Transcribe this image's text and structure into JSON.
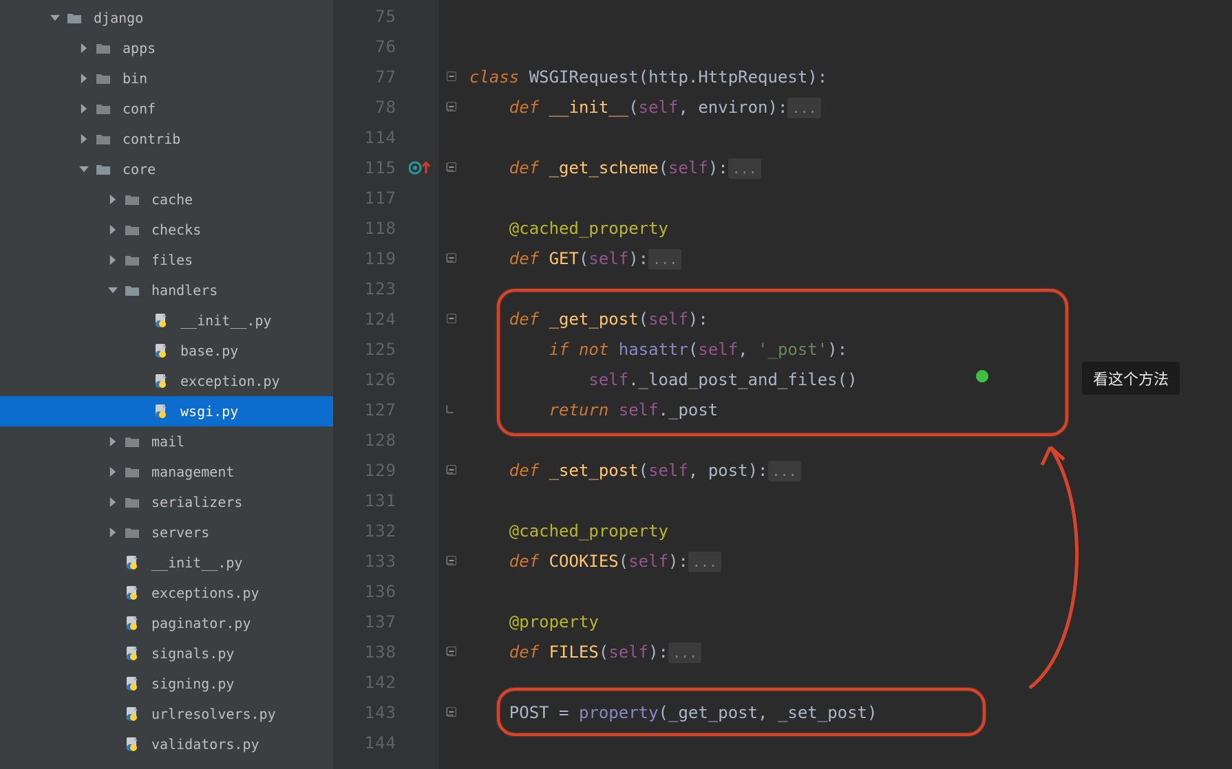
{
  "tree": [
    {
      "depth": 1,
      "kind": "folder",
      "open": true,
      "label": "django"
    },
    {
      "depth": 2,
      "kind": "folder",
      "open": false,
      "label": "apps"
    },
    {
      "depth": 2,
      "kind": "folder",
      "open": false,
      "label": "bin"
    },
    {
      "depth": 2,
      "kind": "folder",
      "open": false,
      "label": "conf"
    },
    {
      "depth": 2,
      "kind": "folder",
      "open": false,
      "label": "contrib"
    },
    {
      "depth": 2,
      "kind": "folder",
      "open": true,
      "label": "core"
    },
    {
      "depth": 3,
      "kind": "folder",
      "open": false,
      "label": "cache"
    },
    {
      "depth": 3,
      "kind": "folder",
      "open": false,
      "label": "checks"
    },
    {
      "depth": 3,
      "kind": "folder",
      "open": false,
      "label": "files"
    },
    {
      "depth": 3,
      "kind": "folder",
      "open": true,
      "label": "handlers"
    },
    {
      "depth": 4,
      "kind": "py",
      "label": "__init__.py"
    },
    {
      "depth": 4,
      "kind": "py",
      "label": "base.py"
    },
    {
      "depth": 4,
      "kind": "py",
      "label": "exception.py"
    },
    {
      "depth": 4,
      "kind": "py",
      "label": "wsgi.py",
      "selected": true
    },
    {
      "depth": 3,
      "kind": "folder",
      "open": false,
      "label": "mail"
    },
    {
      "depth": 3,
      "kind": "folder",
      "open": false,
      "label": "management"
    },
    {
      "depth": 3,
      "kind": "folder",
      "open": false,
      "label": "serializers"
    },
    {
      "depth": 3,
      "kind": "folder",
      "open": false,
      "label": "servers"
    },
    {
      "depth": 3,
      "kind": "py",
      "label": "__init__.py"
    },
    {
      "depth": 3,
      "kind": "py",
      "label": "exceptions.py"
    },
    {
      "depth": 3,
      "kind": "py",
      "label": "paginator.py"
    },
    {
      "depth": 3,
      "kind": "py",
      "label": "signals.py"
    },
    {
      "depth": 3,
      "kind": "py",
      "label": "signing.py"
    },
    {
      "depth": 3,
      "kind": "py",
      "label": "urlresolvers.py"
    },
    {
      "depth": 3,
      "kind": "py",
      "label": "validators.py"
    }
  ],
  "lineNumbers": [
    "75",
    "76",
    "77",
    "78",
    "114",
    "115",
    "117",
    "118",
    "119",
    "123",
    "124",
    "125",
    "126",
    "127",
    "128",
    "129",
    "131",
    "132",
    "133",
    "136",
    "137",
    "138",
    "142",
    "143",
    "144"
  ],
  "markers": {
    "overriding_row": 5
  },
  "folds": {
    "minus": [
      2,
      3,
      5,
      8,
      10,
      15,
      18,
      21,
      23
    ],
    "collapsed_end": [
      3,
      5,
      8,
      13,
      15,
      18,
      21,
      23
    ]
  },
  "code": {
    "kw_class": "class",
    "kw_def": "def",
    "kw_if": "if",
    "kw_not": "not",
    "kw_return": "return",
    "class_name": "WSGIRequest",
    "class_base": "http.HttpRequest",
    "init": "__init__",
    "p_self": "self",
    "p_environ": "environ",
    "get_scheme": "_get_scheme",
    "cached_property": "@cached_property",
    "property_dec": "@property",
    "GET": "GET",
    "get_post": "_get_post",
    "hasattr": "hasattr",
    "post_str": "'_post'",
    "load_call": "._load_post_and_files()",
    "post_attr": "._post",
    "set_post": "_set_post",
    "p_post": "post",
    "COOKIES": "COOKIES",
    "FILES": "FILES",
    "POST": "POST",
    "property_fn": "property",
    "set_post_ref": "_set_post",
    "get_post_ref": "_get_post",
    "ellipsis": "..."
  },
  "annotation": {
    "tooltip": "看这个方法"
  }
}
